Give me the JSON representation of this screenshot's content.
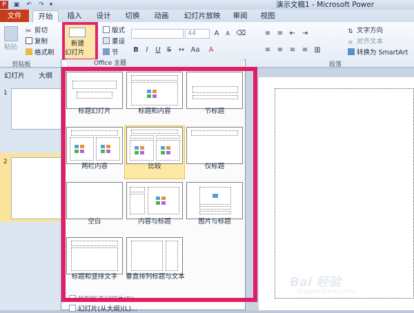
{
  "titlebar": {
    "title": "演示文稿1 - Microsoft Power"
  },
  "tabs": {
    "file": "文件",
    "home": "开始",
    "insert": "插入",
    "design": "设计",
    "transitions": "切换",
    "animations": "动画",
    "slideshow": "幻灯片放映",
    "review": "审阅",
    "view": "视图"
  },
  "clipboard": {
    "paste": "粘贴",
    "cut": "剪切",
    "copy": "复制",
    "format_painter": "格式刷",
    "group": "剪贴板"
  },
  "slides_group": {
    "new_slide": "新建",
    "new_slide_2": "幻灯片",
    "layout": "版式",
    "reset": "重设",
    "section": "节"
  },
  "font": {
    "size": "44"
  },
  "paragraph": {
    "text_direction": "文字方向",
    "align_text": "对齐文本",
    "convert_smartart": "转换为 SmartArt",
    "group": "段落"
  },
  "pane": {
    "slides_tab": "幻灯片",
    "outline_tab": "大纲",
    "thumb1": "1",
    "thumb2": "2"
  },
  "dropdown": {
    "header": "Office 主题"
  },
  "layouts": [
    {
      "label": "标题幻灯片"
    },
    {
      "label": "标题和内容"
    },
    {
      "label": "节标题"
    },
    {
      "label": "两栏内容"
    },
    {
      "label": "比较"
    },
    {
      "label": "仅标题"
    },
    {
      "label": "空白"
    },
    {
      "label": "内容与标题"
    },
    {
      "label": "图片与标题"
    },
    {
      "label": "标题和竖排文字"
    },
    {
      "label": "垂直排列标题与文本"
    }
  ],
  "menu_items": {
    "duplicate": "复制所选幻灯片(D)",
    "from_outline": "幻灯片(从大纲)(L)..."
  },
  "watermark": {
    "text": "Bai 经验",
    "url": "jingyan.baidu.com"
  },
  "colors": {
    "highlight": "#e01e66",
    "file_tab": "#c63d1a",
    "selected_layout": "#fde8a6"
  }
}
